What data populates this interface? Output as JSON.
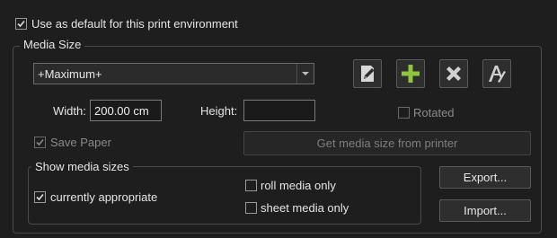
{
  "default_env": {
    "label": "Use as default for this print environment",
    "checked": true
  },
  "media_size": {
    "legend": "Media Size",
    "selected": "+Maximum+",
    "width_label": "Width:",
    "width_value": "200.00 cm",
    "height_label": "Height:",
    "height_value": "",
    "rotated_label": "Rotated",
    "save_paper_label": "Save Paper",
    "get_media_size_label": "Get media size from printer",
    "icons": [
      "edit-icon",
      "add-icon",
      "delete-icon",
      "rename-icon"
    ],
    "colors": {
      "add": "#8fc43f",
      "icon_gray": "#d0d0d0"
    }
  },
  "show_media": {
    "legend": "Show media sizes",
    "currently_appropriate": "currently appropriate",
    "roll_only": "roll media only",
    "sheet_only": "sheet media only"
  },
  "buttons": {
    "export": "Export...",
    "import": "Import..."
  }
}
